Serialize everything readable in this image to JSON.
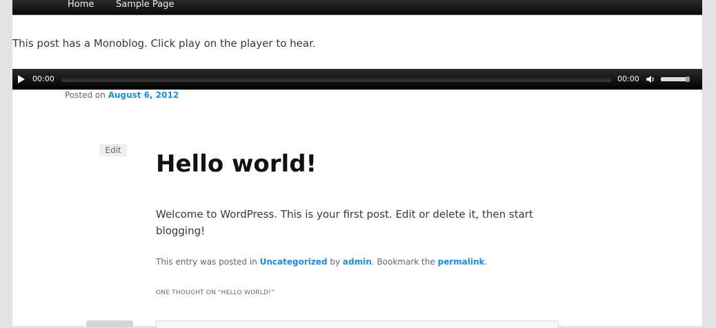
{
  "nav": {
    "home": "Home",
    "sample": "Sample Page"
  },
  "intro": "This post has a Monoblog. Click play on the player to hear.",
  "player": {
    "current_time": "00:00",
    "duration": "00:00"
  },
  "posted": {
    "prefix": "Posted on ",
    "date": "August 6, 2012"
  },
  "edit_label": "Edit",
  "post": {
    "title": "Hello world!",
    "content": "Welcome to WordPress. This is your first post. Edit or delete it, then start blogging!"
  },
  "meta": {
    "prefix": "This entry was posted in ",
    "category": "Uncategorized",
    "by": " by ",
    "author": "admin",
    "bookmark": ". Bookmark the ",
    "permalink": "permalink",
    "end": "."
  },
  "comments_title": "ONE THOUGHT ON “HELLO WORLD!”"
}
